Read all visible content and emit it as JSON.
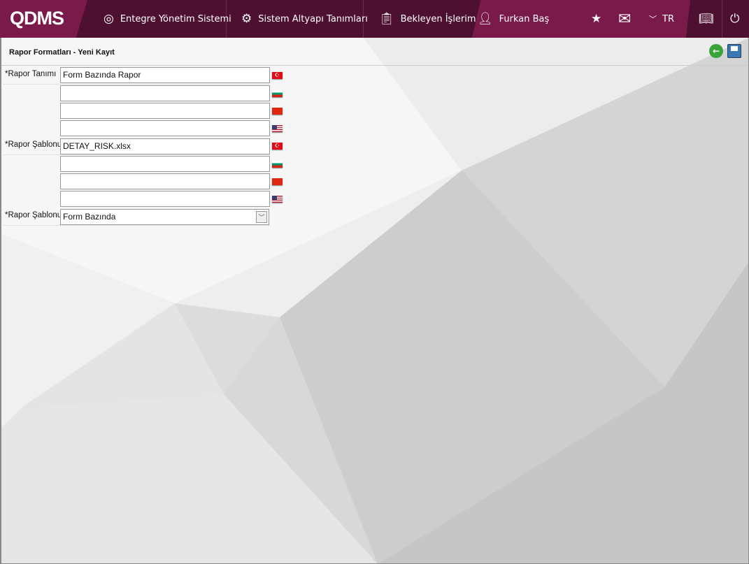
{
  "header": {
    "logo": "QDMS",
    "nav": [
      {
        "label": "Entegre Yönetim Sistemi",
        "icon": "qdms-icon"
      },
      {
        "label": "Sistem Altyapı Tanımları",
        "icon": "gear-icon"
      },
      {
        "label": "Bekleyen İşlerim",
        "icon": "clipboard-icon"
      },
      {
        "label": "Furkan Baş",
        "icon": "user-icon"
      }
    ],
    "language": "TR"
  },
  "page": {
    "title": "Rapor Formatları - Yeni Kayıt",
    "fields": {
      "rapor_tanimi_label": "*Rapor Tanımı",
      "rapor_tanimi": [
        "Form Bazında Rapor",
        "",
        "",
        ""
      ],
      "rapor_sablonu_label": "*Rapor Şablonu",
      "rapor_sablonu": [
        "DETAY_RISK.xlsx",
        "",
        "",
        ""
      ],
      "rapor_sablonu_select_label": "*Rapor Şablonu",
      "rapor_sablonu_select": "Form Bazında"
    },
    "flags": [
      "tr",
      "bg",
      "cn",
      "us"
    ]
  }
}
